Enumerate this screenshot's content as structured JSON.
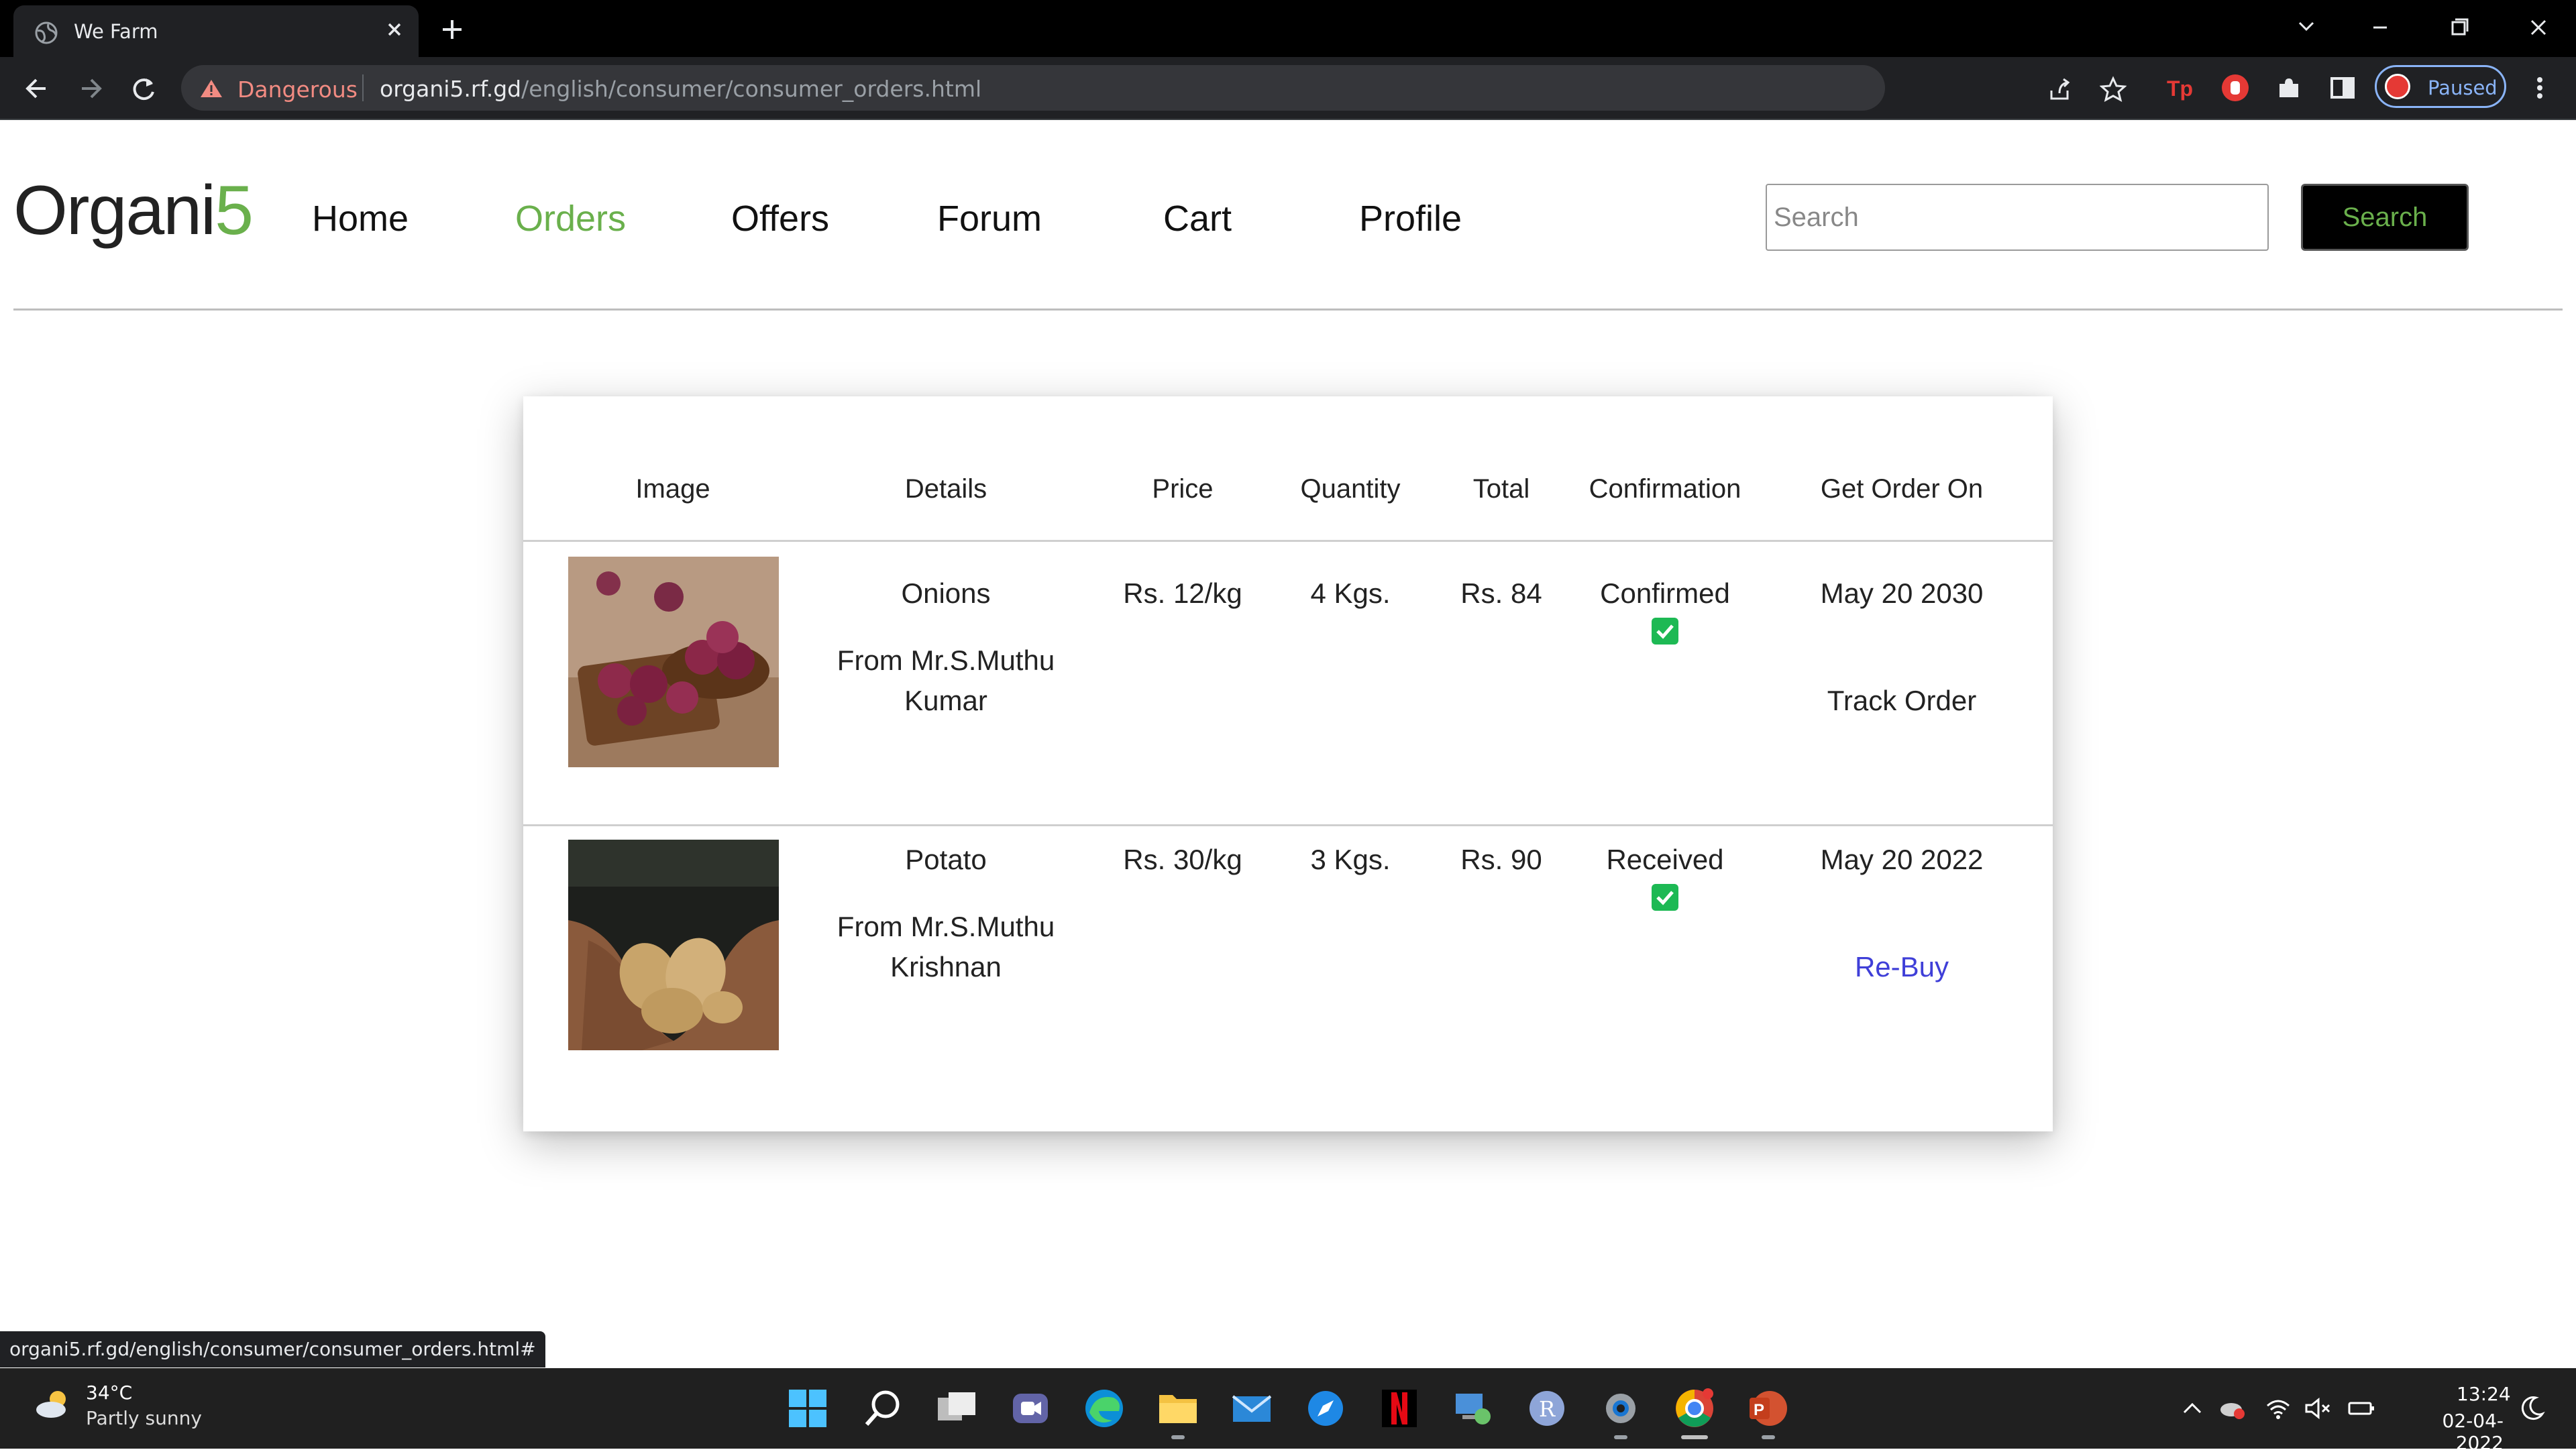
{
  "browser": {
    "tab_title": "We Farm",
    "security_label": "Dangerous",
    "url_host": "organi5.rf.gd",
    "url_path": "/english/consumer/consumer_orders.html",
    "profile_label": "Paused"
  },
  "site": {
    "logo_text": "Organi",
    "logo_accent": "5",
    "brand_color": "#6ab04c",
    "nav": [
      {
        "label": "Home"
      },
      {
        "label": "Orders"
      },
      {
        "label": "Offers"
      },
      {
        "label": "Forum"
      },
      {
        "label": "Cart"
      },
      {
        "label": "Profile"
      }
    ],
    "active_nav": "Orders",
    "search_placeholder": "Search",
    "search_button": "Search"
  },
  "orders": {
    "columns": [
      "Image",
      "Details",
      "Price",
      "Quantity",
      "Total",
      "Confirmation",
      "Get Order On"
    ],
    "rows": [
      {
        "image_icon": "onions-photo",
        "product": "Onions",
        "seller_line1": "From Mr.S.Muthu",
        "seller_line2": "Kumar",
        "price": "Rs. 12/kg",
        "quantity": "4 Kgs.",
        "total": "Rs. 84",
        "status": "Confirmed",
        "status_checked": true,
        "date": "May 20 2030",
        "action": "Track Order"
      },
      {
        "image_icon": "potato-photo",
        "product": "Potato",
        "seller_line1": "From Mr.S.Muthu",
        "seller_line2": "Krishnan",
        "price": "Rs. 30/kg",
        "quantity": "3 Kgs.",
        "total": "Rs. 90",
        "status": "Received",
        "status_checked": true,
        "date": "May 20 2022",
        "action": "Re-Buy"
      }
    ]
  },
  "status_bar_url": "organi5.rf.gd/english/consumer/consumer_orders.html#",
  "taskbar": {
    "weather_temp": "34°C",
    "weather_desc": "Partly sunny",
    "time": "13:24",
    "date": "02-04-2022"
  }
}
